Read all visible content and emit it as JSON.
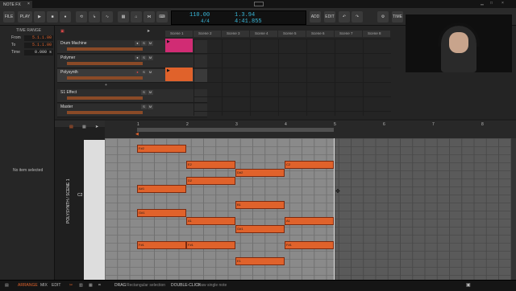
{
  "window": {
    "tab_label": "NOTE FX"
  },
  "toolbar": {
    "file": "FILE",
    "play": "PLAY",
    "add": "ADD",
    "edit": "EDIT",
    "time": "TIME",
    "tempo": "110.00",
    "position": "1.3.94",
    "signature": "4/4",
    "time_readout": "4:41.855"
  },
  "inspector": {
    "section": "TIME RANGE",
    "from_label": "From",
    "from_value": "5.1.1.00",
    "to_label": "To",
    "to_value": "5.1.1.00",
    "time_label": "Time",
    "time_value": "0.000 s",
    "empty_label": "No item selected"
  },
  "arranger": {
    "tracks": [
      {
        "name": "Drum Machine"
      },
      {
        "name": "Polymer"
      },
      {
        "name": "Polysynth"
      },
      {
        "name": "S1 Effect"
      },
      {
        "name": "Master"
      }
    ],
    "scenes": [
      "Scene 1",
      "Scene 2",
      "Scene 3",
      "Scene 4",
      "Scene 5",
      "Scene 6",
      "Scene 7",
      "Scene 8"
    ]
  },
  "editor": {
    "side_label": "POLYSYNTH / SCENE 1",
    "octave_c2": "C2",
    "bar_numbers": [
      "1",
      "2",
      "3",
      "4",
      "5",
      "6",
      "7",
      "8"
    ],
    "notes": [
      {
        "label": "F#2"
      },
      {
        "label": "E2"
      },
      {
        "label": "D#2"
      },
      {
        "label": "C2"
      },
      {
        "label": "D2"
      },
      {
        "label": "A#1"
      },
      {
        "label": "B1"
      },
      {
        "label": "G#1"
      },
      {
        "label": "A1"
      },
      {
        "label": "A1"
      },
      {
        "label": "G#1"
      },
      {
        "label": "F#1"
      },
      {
        "label": "F#1"
      },
      {
        "label": "F#1"
      },
      {
        "label": "E1"
      }
    ]
  },
  "status": {
    "arrange": "ARRANGE",
    "mix": "MIX",
    "edit": "EDIT",
    "drag_key": "DRAG",
    "drag_text": "Rectangular selection",
    "dbl_key": "DOUBLE-CLICK",
    "dbl_text": "Draw single note"
  },
  "colors": {
    "accent": "#e0622b",
    "lcd": "#38b7d8",
    "drum_clip": "#d12c74",
    "polysynth_clip": "#e0622b"
  }
}
